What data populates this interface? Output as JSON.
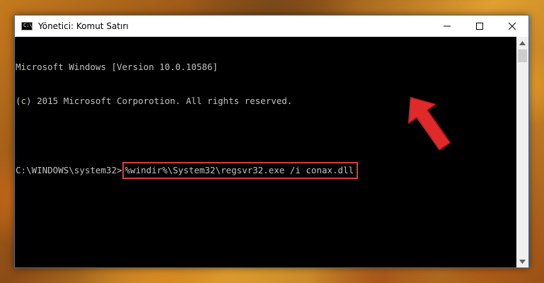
{
  "window": {
    "title": "Yönetici: Komut Satırı",
    "icon": "cmd-icon",
    "app_icon_text": "C:\\"
  },
  "console": {
    "lines": [
      "Microsoft Windows [Version 10.0.10586]",
      "(c) 2015 Microsoft Corporotion. All rights reserved.",
      ""
    ],
    "prompt": "C:\\WINDOWS\\system32>",
    "command": "%windir%\\System32\\regsvr32.exe /i conax.dll"
  },
  "colors": {
    "console_bg": "#000000",
    "console_text": "#c0c0c0",
    "highlight_box": "#e53a3a",
    "arrow": "#e02a2a"
  },
  "icons": [
    "minimize-icon",
    "maximize-icon",
    "close-icon",
    "scroll-up-icon",
    "scroll-down-icon",
    "red-arrow-icon"
  ]
}
